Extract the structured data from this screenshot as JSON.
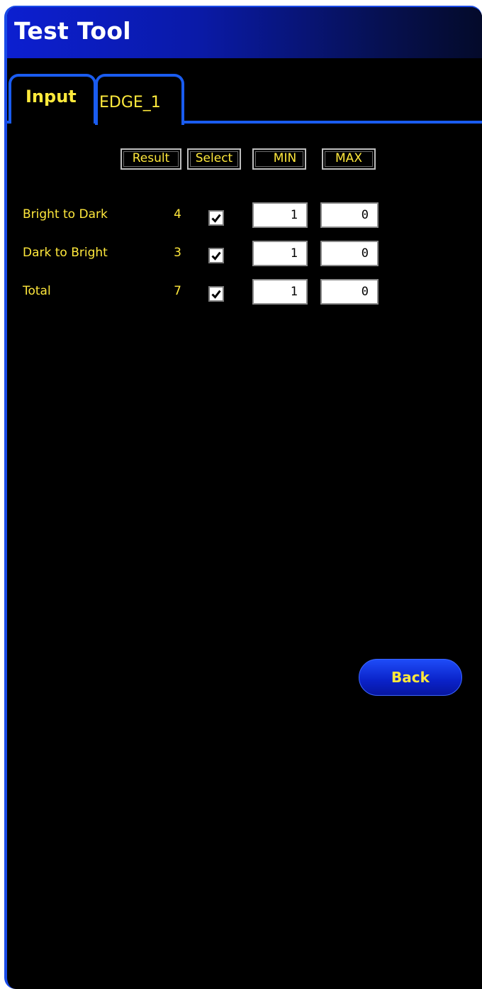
{
  "window": {
    "title": "Test Tool"
  },
  "tabs": [
    {
      "label": "Input",
      "active": false
    },
    {
      "label": "EDGE_1",
      "active": true
    }
  ],
  "table": {
    "headers": {
      "result": "Result",
      "select": "Select",
      "min": "MIN",
      "max": "MAX"
    },
    "rows": [
      {
        "label": "Bright to Dark",
        "result": "4",
        "selected": true,
        "min": "1",
        "max": "0"
      },
      {
        "label": "Dark to Bright",
        "result": "3",
        "selected": true,
        "min": "1",
        "max": "0"
      },
      {
        "label": "Total",
        "result": "7",
        "selected": true,
        "min": "1",
        "max": "0"
      }
    ]
  },
  "actions": {
    "back_label": "Back"
  },
  "colors": {
    "accent": "#1a5cf0",
    "text": "#ffe83c",
    "background": "#000000"
  },
  "icons": {
    "checkbox_checked": "checkmark-icon"
  }
}
